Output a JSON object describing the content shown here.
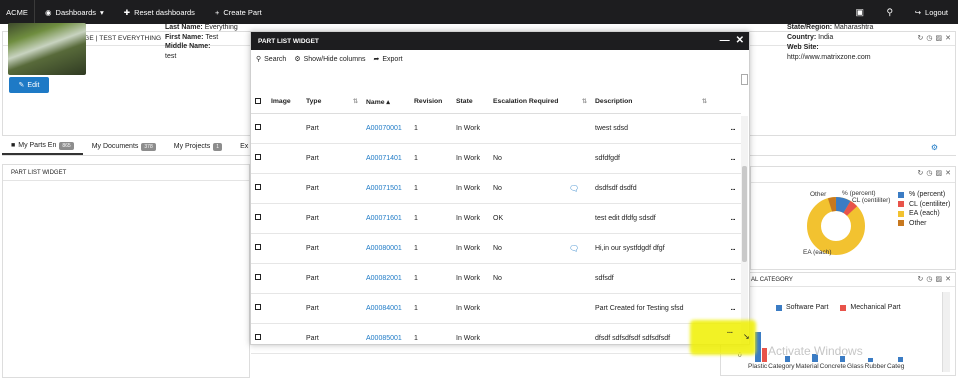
{
  "nav": {
    "brand": "ACME",
    "dashboards": "Dashboards",
    "reset": "Reset dashboards",
    "create_part": "Create Part",
    "logout": "Logout"
  },
  "home": {
    "title": "PERSONAL HOME PAGE | TEST EVERYTHING",
    "edit_label": "Edit",
    "last_name_label": "Last Name:",
    "last_name": "Everything",
    "first_name_label": "First Name:",
    "first_name": "Test",
    "middle_name_label": "Middle Name:",
    "middle_name": "",
    "extra": "test",
    "state_label": "State/Region:",
    "state": "Maharashtra",
    "country_label": "Country:",
    "country": "India",
    "website_label": "Web Site:",
    "website": "http://www.matrixzone.com"
  },
  "tabs": [
    {
      "label": "My Parts En",
      "badge": "865"
    },
    {
      "label": "My Documents",
      "badge": "378"
    },
    {
      "label": "My Projects",
      "badge": "1"
    },
    {
      "label": "Ex",
      "badge": ""
    }
  ],
  "plw_bg_title": "PART LIST WIDGET",
  "modal": {
    "title": "PART LIST WIDGET",
    "search": "Search",
    "show_hide": "Show/Hide columns",
    "export": "Export",
    "columns": [
      "Image",
      "Type",
      "Name",
      "Revision",
      "State",
      "Escalation Required",
      "",
      "Description"
    ],
    "rows": [
      {
        "type": "Part",
        "name": "A00070001",
        "rev": "1",
        "state": "In Work",
        "esc": "",
        "comment": false,
        "desc": "twest sdsd"
      },
      {
        "type": "Part",
        "name": "A00071401",
        "rev": "1",
        "state": "In Work",
        "esc": "No",
        "comment": false,
        "desc": "sdfdfgdf"
      },
      {
        "type": "Part",
        "name": "A00071501",
        "rev": "1",
        "state": "In Work",
        "esc": "No",
        "comment": true,
        "desc": "dsdfsdf dsdfd"
      },
      {
        "type": "Part",
        "name": "A00071601",
        "rev": "1",
        "state": "In Work",
        "esc": "OK",
        "comment": false,
        "desc": "test edit dfdfg sdsdf"
      },
      {
        "type": "Part",
        "name": "A00080001",
        "rev": "1",
        "state": "In Work",
        "esc": "No",
        "comment": true,
        "desc": "Hi,in our systfdgdf dfgf"
      },
      {
        "type": "Part",
        "name": "A00082001",
        "rev": "1",
        "state": "In Work",
        "esc": "No",
        "comment": false,
        "desc": "sdfsdf"
      },
      {
        "type": "Part",
        "name": "A00084001",
        "rev": "1",
        "state": "In Work",
        "esc": "",
        "comment": false,
        "desc": "Part Created for Testing sfsd"
      },
      {
        "type": "Part",
        "name": "A00085001",
        "rev": "1",
        "state": "In Work",
        "esc": "",
        "comment": false,
        "desc": "dfsdf sdfsdfsdf sdfsdfsdf"
      }
    ],
    "dots": "..."
  },
  "pie": {
    "labels": {
      "other": "Other",
      "percent": "% (percent)",
      "cl": "CL (centiliter)",
      "ea": "EA (each)"
    },
    "legend": [
      {
        "name": "% (percent)",
        "color": "#3b7cc4"
      },
      {
        "name": "CL (centiliter)",
        "color": "#e8534a"
      },
      {
        "name": "EA (each)",
        "color": "#f2c230"
      },
      {
        "name": "Other",
        "color": "#c7781f"
      }
    ]
  },
  "bar_widget": {
    "title": "AL CATEGORY",
    "legend": [
      {
        "name": "Software Part",
        "color": "#3b7cc4"
      },
      {
        "name": "Mechanical Part",
        "color": "#e8534a"
      }
    ],
    "zero": "0",
    "categories": [
      "Plastic",
      "Category",
      "Material",
      "Concrete",
      "Glass",
      "Rubber",
      "Categ"
    ],
    "watermark": "Activate Windows"
  }
}
